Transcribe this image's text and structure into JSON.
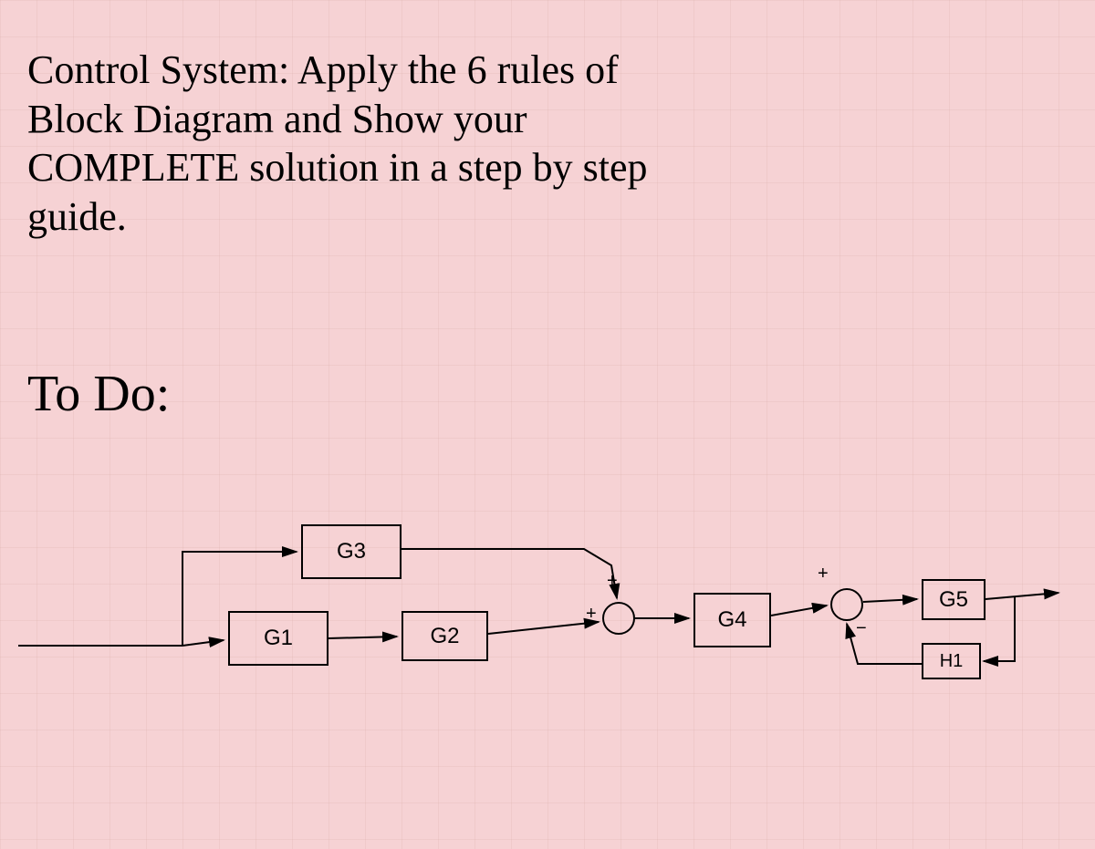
{
  "title": "Control System: Apply the 6 rules of Block Diagram and Show your COMPLETE solution in a step by step guide.",
  "todo_label": "To Do:",
  "blocks": {
    "g1": "G1",
    "g2": "G2",
    "g3": "G3",
    "g4": "G4",
    "g5": "G5",
    "h1": "H1"
  },
  "summing_points": {
    "s1": {
      "top_sign": "+",
      "left_sign": "+"
    },
    "s2": {
      "top_sign": "+",
      "bottom_sign": "−"
    }
  }
}
